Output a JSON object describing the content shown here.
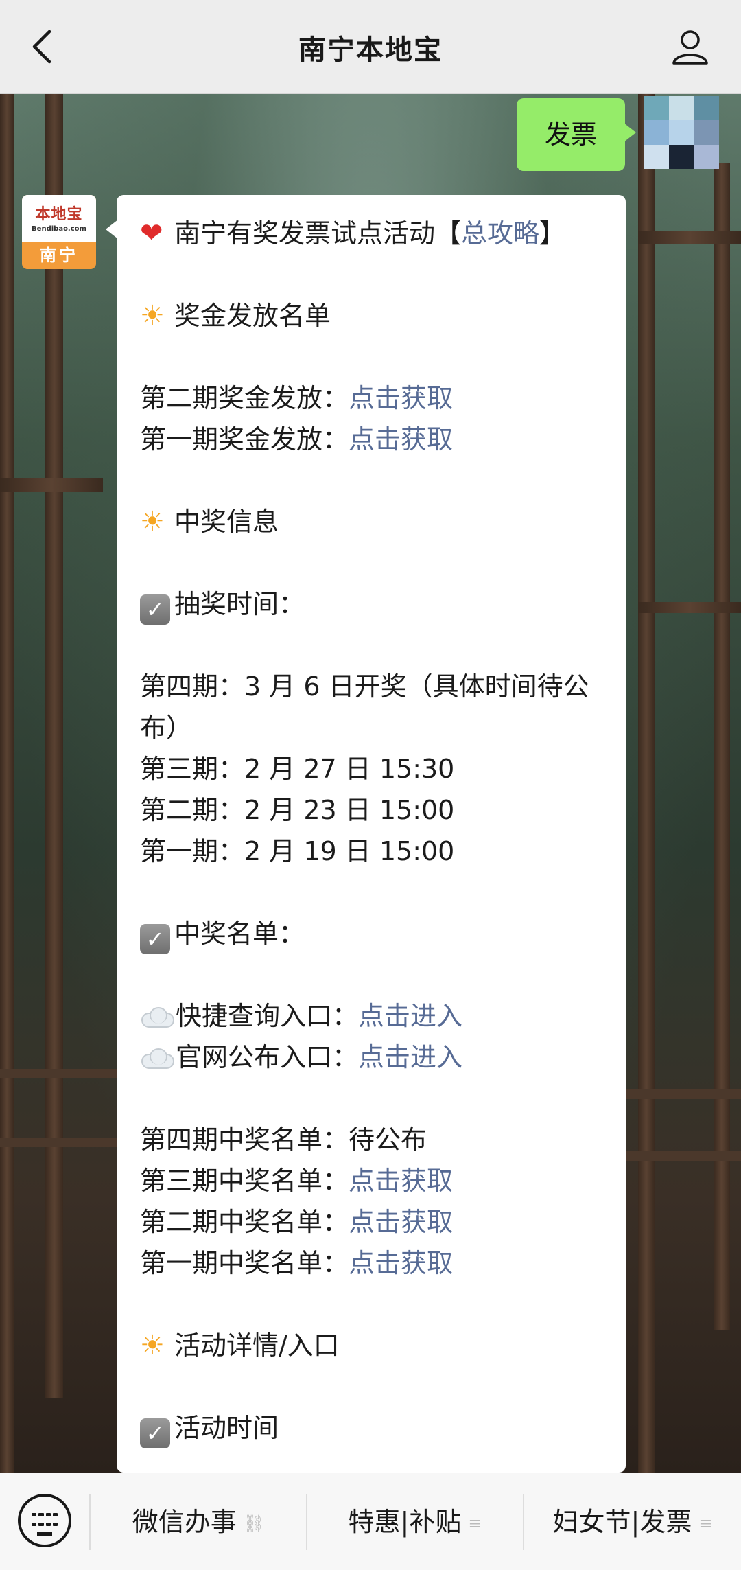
{
  "header": {
    "title": "南宁本地宝"
  },
  "chat": {
    "sent_message": "发票",
    "bot_avatar": {
      "logo_text": "本地宝",
      "logo_url_text": "Bendibao.com",
      "city": "南宁"
    },
    "article": {
      "title_prefix": "南宁有奖发票试点活动【",
      "title_link": "总攻略",
      "title_suffix": "】",
      "section_prizes": "奖金发放名单",
      "prize_round2_label": "第二期奖金发放：",
      "prize_round2_link": "点击获取",
      "prize_round1_label": "第一期奖金发放：",
      "prize_round1_link": "点击获取",
      "section_winning_info": "中奖信息",
      "draw_time_heading": "抽奖时间：",
      "draw_round4": "第四期：3 月 6 日开奖（具体时间待公布）",
      "draw_round3": "第三期：2 月 27 日 15:30",
      "draw_round2": "第二期：2 月 23 日 15:00",
      "draw_round1": "第一期：2 月 19 日 15:00",
      "winners_heading": "中奖名单：",
      "quick_query_label": "快捷查询入口：",
      "quick_query_link": "点击进入",
      "official_label": "官网公布入口：",
      "official_link": "点击进入",
      "winners_round4_label": "第四期中奖名单：",
      "winners_round4_value": "待公布",
      "winners_round3_label": "第三期中奖名单：",
      "winners_round3_link": "点击获取",
      "winners_round2_label": "第二期中奖名单：",
      "winners_round2_link": "点击获取",
      "winners_round1_label": "第一期中奖名单：",
      "winners_round1_link": "点击获取",
      "section_activity": "活动详情/入口",
      "activity_time_heading": "活动时间"
    }
  },
  "bottom_menu": {
    "item1": "微信办事",
    "item2": "特惠|补贴",
    "item3": "妇女节|发票"
  },
  "colors": {
    "link": "#576b95",
    "sent_bubble": "#95ec69",
    "header_bg": "#ededed"
  }
}
